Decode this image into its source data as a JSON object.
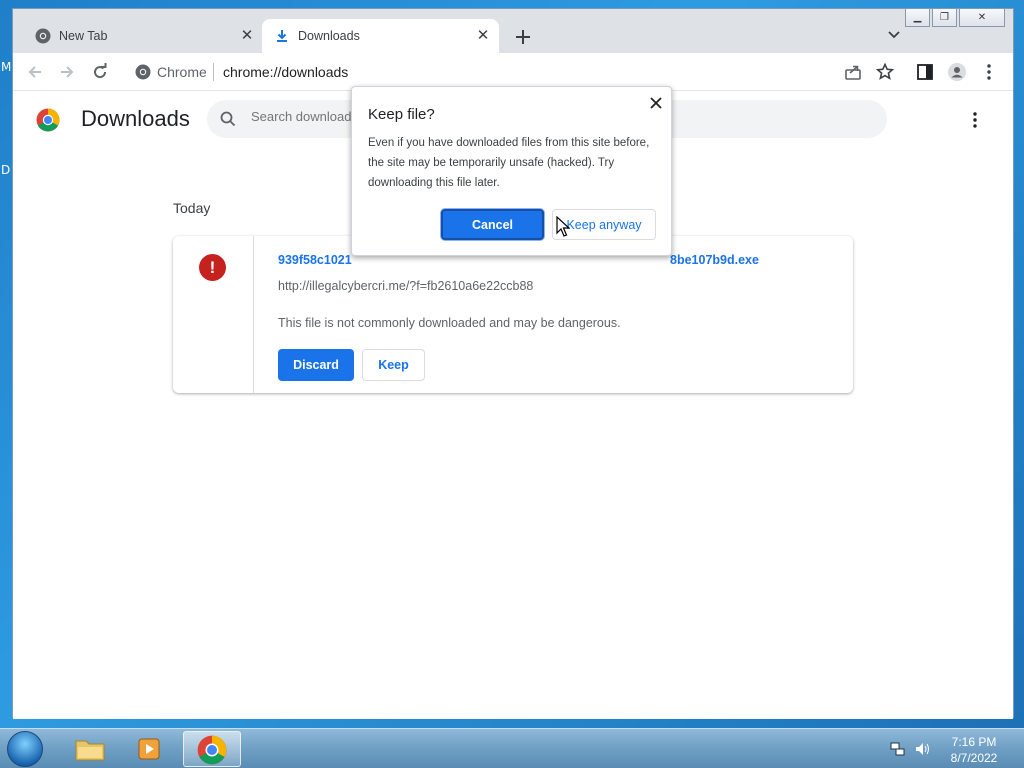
{
  "desktop": {
    "letters": [
      "M",
      "D"
    ]
  },
  "browser": {
    "tabs": [
      {
        "label": "New Tab",
        "icon": "chrome-icon"
      },
      {
        "label": "Downloads",
        "icon": "download-icon"
      }
    ],
    "omnibox": {
      "site": "Chrome",
      "url": "chrome://downloads"
    }
  },
  "downloads_page": {
    "title": "Downloads",
    "search_placeholder": "Search downloads",
    "section_label": "Today",
    "item": {
      "filename_visible_start": "939f58c1021",
      "filename_visible_end": "8be107b9d.exe",
      "url": "http://illegalcybercri.me/?f=fb2610a6e22ccb88",
      "warning": "This file is not commonly downloaded and may be dangerous.",
      "discard_label": "Discard",
      "keep_label": "Keep"
    }
  },
  "dialog": {
    "title": "Keep file?",
    "body": "Even if you have downloaded files from this site before, the site may be temporarily unsafe (hacked). Try downloading this file later.",
    "cancel_label": "Cancel",
    "keep_anyway_label": "Keep anyway"
  },
  "taskbar": {
    "time": "7:16 PM",
    "date": "8/7/2022"
  },
  "colors": {
    "accent": "#1a73e8",
    "danger": "#c5221f"
  }
}
